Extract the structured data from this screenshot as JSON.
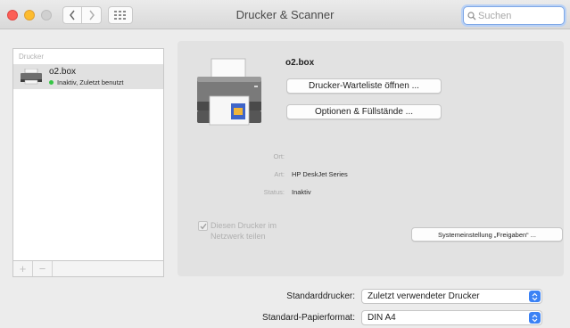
{
  "window": {
    "title": "Drucker & Scanner",
    "search_placeholder": "Suchen"
  },
  "printer_list": {
    "header": "Drucker",
    "items": [
      {
        "name": "o2.box",
        "status": "Inaktiv, Zuletzt benutzt",
        "status_color": "#36c545"
      }
    ],
    "add_label": "+",
    "remove_label": "−"
  },
  "details": {
    "printer_name": "o2.box",
    "queue_button": "Drucker-Warteliste öffnen ...",
    "options_button": "Optionen & Füllstände ...",
    "ort_label": "Ort:",
    "ort_value": "",
    "art_label": "Art:",
    "art_value": "HP DeskJet Series",
    "status_label": "Status:",
    "status_value": "Inaktiv",
    "share_checked": true,
    "share_label": "Diesen Drucker im Netzwerk teilen",
    "sharing_prefs_button": "Systemeinstellung „Freigaben“ ..."
  },
  "defaults": {
    "default_printer_label": "Standarddrucker:",
    "default_printer_value": "Zuletzt verwendeter Drucker",
    "paper_size_label": "Standard-Papierformat:",
    "paper_size_value": "DIN A4"
  },
  "colors": {
    "accent": "#3b82f5",
    "close": "#fc5f57",
    "minimize": "#fdbc2e"
  }
}
